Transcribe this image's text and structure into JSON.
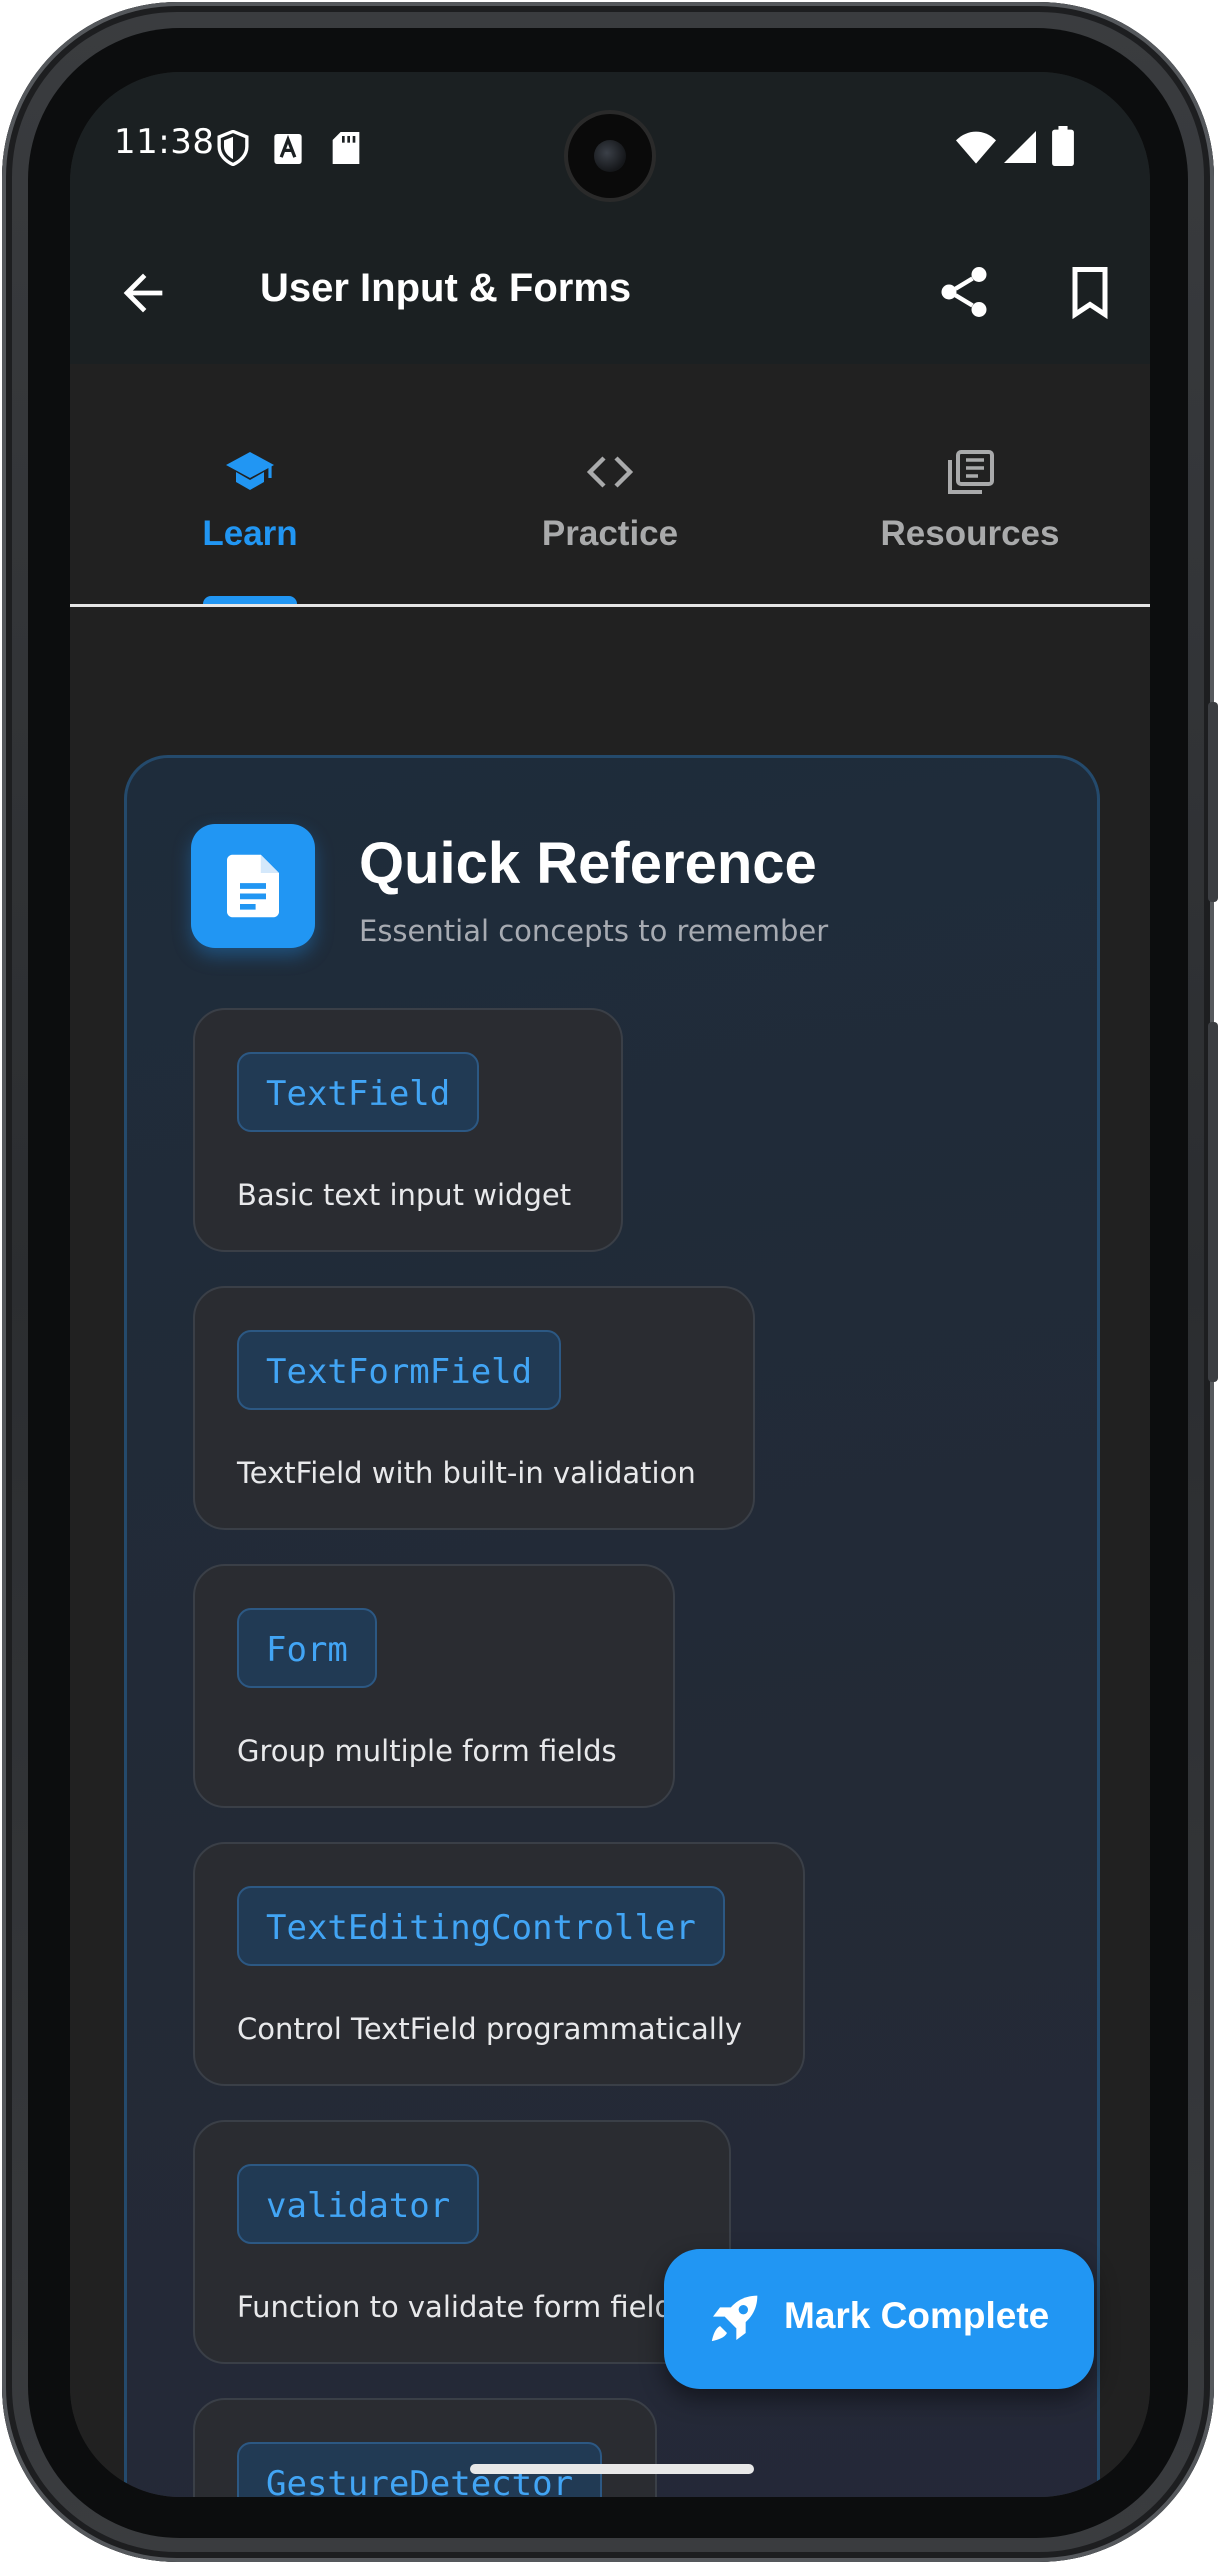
{
  "status_bar": {
    "time": "11:38"
  },
  "app_bar": {
    "title": "User Input & Forms"
  },
  "tabs": [
    {
      "label": "Learn",
      "icon": "school-icon",
      "active": true
    },
    {
      "label": "Practice",
      "icon": "code-icon",
      "active": false
    },
    {
      "label": "Resources",
      "icon": "library-books-icon",
      "active": false
    }
  ],
  "quick_reference": {
    "title": "Quick Reference",
    "subtitle": "Essential concepts to remember",
    "items": [
      {
        "term": "TextField",
        "description": "Basic text input widget"
      },
      {
        "term": "TextFormField",
        "description": "TextField with built-in validation"
      },
      {
        "term": "Form",
        "description": "Group multiple form fields"
      },
      {
        "term": "TextEditingController",
        "description": "Control TextField programmatically"
      },
      {
        "term": "validator",
        "description": "Function to validate form fields"
      },
      {
        "term": "GestureDetector",
        "description": ""
      }
    ]
  },
  "fab": {
    "label": "Mark Complete",
    "icon": "rocket-icon"
  },
  "colors": {
    "accent": "#2196f3",
    "background": "#212121",
    "app_bar": "#1b2022",
    "card_border": "#244a6c"
  }
}
